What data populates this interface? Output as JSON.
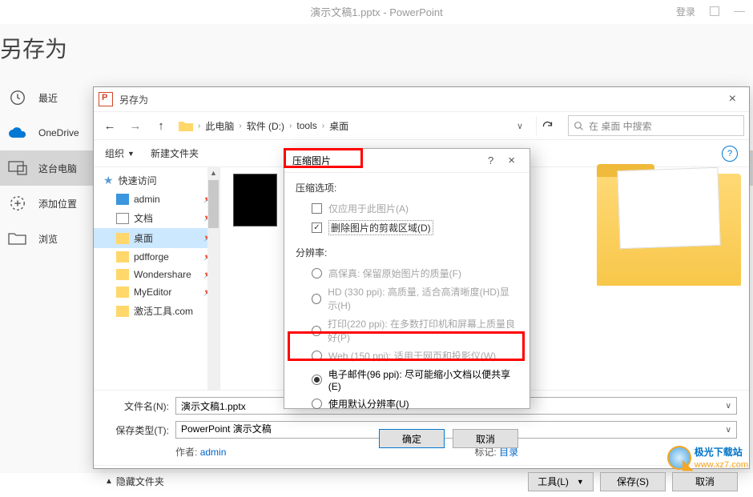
{
  "app": {
    "title": "演示文稿1.pptx  -  PowerPoint",
    "login": "登录"
  },
  "saveas_page": {
    "title": "另存为",
    "items": [
      "最近",
      "OneDrive",
      "这台电脑",
      "添加位置",
      "浏览"
    ]
  },
  "dlg": {
    "title": "另存为",
    "breadcrumb": [
      "此电脑",
      "软件 (D:)",
      "tools",
      "桌面"
    ],
    "search_placeholder": "在 桌面 中搜索",
    "organize": "组织",
    "newfolder": "新建文件夹",
    "sidebar": {
      "quick": "快速访问",
      "items": [
        "admin",
        "文档",
        "桌面",
        "pdfforge",
        "Wondershare",
        "MyEditor",
        "激活工具.com"
      ]
    },
    "filename_label": "文件名(N):",
    "filename": "演示文稿1.pptx",
    "savetype_label": "保存类型(T):",
    "savetype": "PowerPoint 演示文稿",
    "author_label": "作者:",
    "author": "admin",
    "tags_label": "标记:",
    "tags": "目录",
    "hide": "隐藏文件夹",
    "tools": "工具(L)",
    "save": "保存(S)",
    "cancel": "取消"
  },
  "compress": {
    "title": "压缩图片",
    "opts_title": "压缩选项:",
    "opt_apply": "仅应用于此图片(A)",
    "opt_crop": "删除图片的剪裁区域(D)",
    "res_title": "分辨率:",
    "r_hifi": "高保真: 保留原始图片的质量(F)",
    "r_hd": "HD (330 ppi): 高质量, 适合高清晰度(HD)显示(H)",
    "r_print": "打印(220 ppi): 在多数打印机和屏幕上质量良好(P)",
    "r_web": "Web (150 ppi): 适用于网页和投影仪(W)",
    "r_email": "电子邮件(96 ppi): 尽可能缩小文档以便共享(E)",
    "r_default": "使用默认分辨率(U)",
    "ok": "确定",
    "cancel": "取消"
  },
  "watermark": {
    "brand": "极光下载站",
    "url": "www.xz7.com"
  }
}
